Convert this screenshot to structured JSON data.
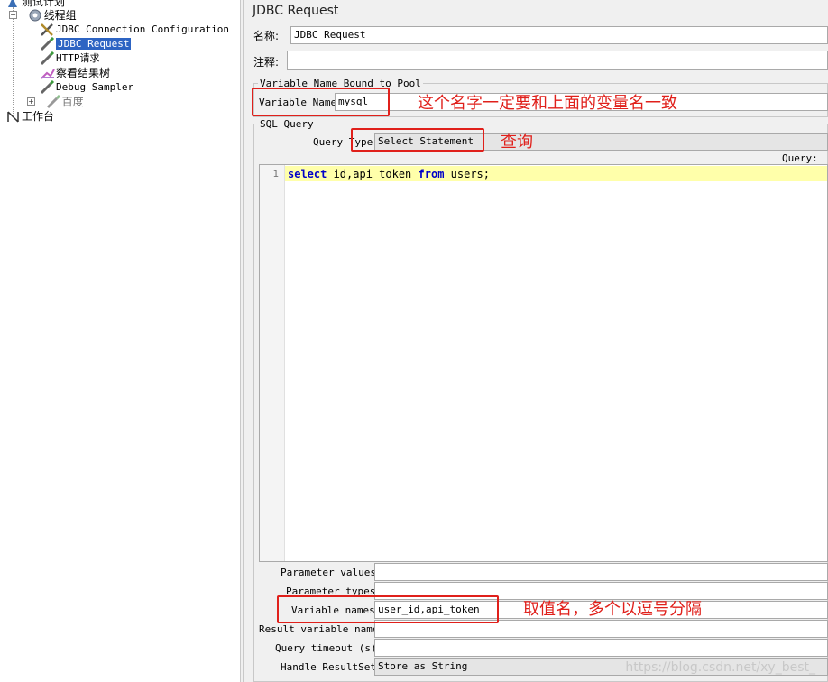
{
  "tree": {
    "items": [
      {
        "label": "测试计划"
      },
      {
        "label": "线程组"
      },
      {
        "label": "JDBC Connection Configuration"
      },
      {
        "label": "JDBC Request"
      },
      {
        "label": "HTTP请求"
      },
      {
        "label": "察看结果树"
      },
      {
        "label": "Debug Sampler"
      },
      {
        "label": "百度"
      },
      {
        "label": "工作台"
      }
    ]
  },
  "panel": {
    "title": "JDBC Request",
    "name_label": "名称:",
    "name_value": "JDBC Request",
    "comment_label": "注释:",
    "comment_value": "",
    "pool_group_title": "Variable Name Bound to Pool",
    "variable_name_label": "Variable Name:",
    "variable_name_value": "mysql",
    "sql_group_title": "SQL Query",
    "query_type_label": "Query Type:",
    "query_type_value": "Select Statement",
    "query_label": "Query:",
    "editor_line_number": "1",
    "code": {
      "kw1": "select",
      "part1": " id,api_token ",
      "kw2": "from",
      "part2": " users;"
    },
    "parameter_values_label": "Parameter values:",
    "parameter_values_value": "",
    "parameter_types_label": "Parameter types:",
    "parameter_types_value": "",
    "variable_names_label": "Variable names:",
    "variable_names_value": "user_id,api_token",
    "result_variable_label": "Result variable name:",
    "result_variable_value": "",
    "query_timeout_label": "Query timeout (s):",
    "query_timeout_value": "",
    "handle_resultset_label": "Handle ResultSet:",
    "handle_resultset_value": "Store as String"
  },
  "annotations": {
    "note1": "这个名字一定要和上面的变量名一致",
    "note2": "查询",
    "note3": "取值名，多个以逗号分隔"
  },
  "watermark": "https://blog.csdn.net/xy_best_",
  "colors": {
    "annotation": "#e0201b",
    "selection": "#2d64c3",
    "keyword": "#0000c8",
    "current_line": "#ffffaa"
  }
}
